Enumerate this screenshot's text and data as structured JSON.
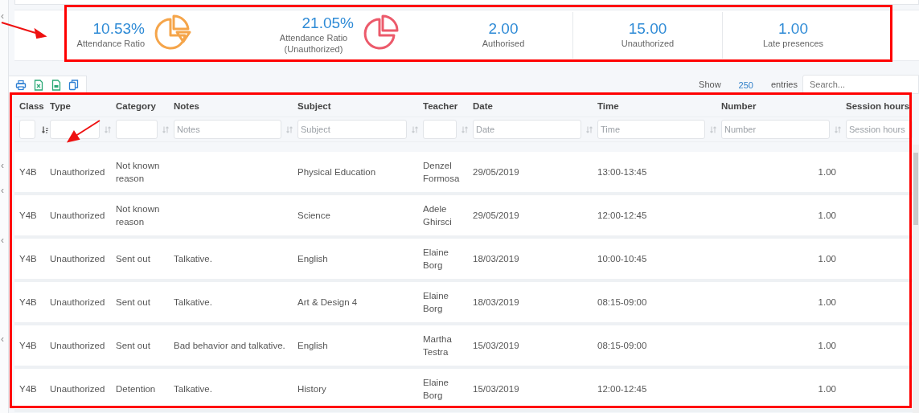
{
  "gutter_marks": [
    "‹",
    "‹",
    "‹",
    "‹",
    "‹"
  ],
  "stats": {
    "highlighted": true,
    "items": [
      {
        "value": "10.53%",
        "label": "Attendance Ratio",
        "kind": "ratio",
        "color": "#f5a54a"
      },
      {
        "value": "21.05%",
        "label": "Attendance Ratio (Unauthorized)",
        "kind": "ratio",
        "color": "#ec5a6b"
      },
      {
        "value": "2.00",
        "label": "Authorised",
        "kind": "count"
      },
      {
        "value": "15.00",
        "label": "Unauthorized",
        "kind": "count"
      },
      {
        "value": "1.00",
        "label": "Late presences",
        "kind": "count"
      }
    ]
  },
  "annotations": [
    {
      "kind": "arrow"
    },
    {
      "kind": "arrow"
    }
  ],
  "toolbar": [
    {
      "kind": "print"
    },
    {
      "kind": "excel"
    },
    {
      "kind": "csv"
    },
    {
      "kind": "copy"
    }
  ],
  "length_control": {
    "before": "Show",
    "value": "250",
    "after": "entries"
  },
  "search": {
    "placeholder": "Search..."
  },
  "table": {
    "highlighted": true,
    "columns": [
      {
        "label": "Class",
        "sorted": true
      },
      {
        "label": "Type",
        "sorted": false
      },
      {
        "label": "Category",
        "sorted": false
      },
      {
        "label": "Notes",
        "sorted": false,
        "placeholder": "Notes"
      },
      {
        "label": "Subject",
        "sorted": false,
        "placeholder": "Subject"
      },
      {
        "label": "Teacher",
        "sorted": false
      },
      {
        "label": "Date",
        "sorted": false,
        "placeholder": "Date"
      },
      {
        "label": "Time",
        "sorted": false,
        "placeholder": "Time"
      },
      {
        "label": "Number",
        "sorted": false,
        "placeholder": "Number"
      },
      {
        "label": "Session hours",
        "placeholder": "Session hours"
      }
    ],
    "rows": [
      [
        "Y4B",
        "Unauthorized",
        "Not known reason",
        "",
        "Physical Education",
        "Denzel Formosa",
        "29/05/2019",
        "13:00-13:45",
        "1.00",
        ""
      ],
      [
        "Y4B",
        "Unauthorized",
        "Not known reason",
        "",
        "Science",
        "Adele Ghirsci",
        "29/05/2019",
        "12:00-12:45",
        "1.00",
        ""
      ],
      [
        "Y4B",
        "Unauthorized",
        "Sent out",
        "Talkative.",
        "English",
        "Elaine Borg",
        "18/03/2019",
        "10:00-10:45",
        "1.00",
        ""
      ],
      [
        "Y4B",
        "Unauthorized",
        "Sent out",
        "Talkative.",
        "Art & Design 4",
        "Elaine Borg",
        "18/03/2019",
        "08:15-09:00",
        "1.00",
        ""
      ],
      [
        "Y4B",
        "Unauthorized",
        "Sent out",
        "Bad behavior and talkative.",
        "English",
        "Martha Testra",
        "15/03/2019",
        "08:15-09:00",
        "1.00",
        ""
      ],
      [
        "Y4B",
        "Unauthorized",
        "Detention",
        "Talkative.",
        "History",
        "Elaine Borg",
        "15/03/2019",
        "12:00-12:45",
        "1.00",
        ""
      ]
    ]
  }
}
